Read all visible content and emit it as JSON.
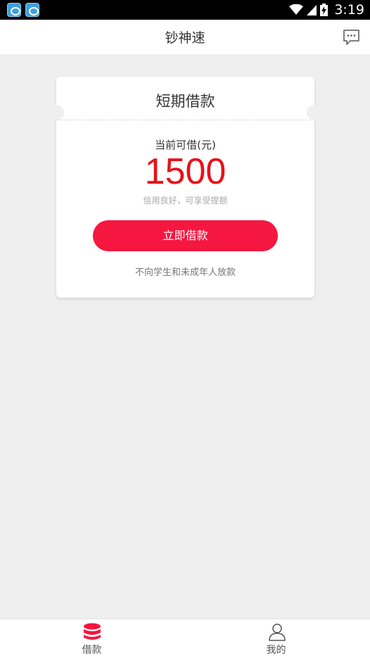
{
  "status_bar": {
    "time": "3:19",
    "notification_icons": [
      "app-icon",
      "app-icon"
    ]
  },
  "header": {
    "title": "钞神速",
    "message_icon": "message-bubble-icon"
  },
  "card": {
    "title": "短期借款",
    "limit_label": "当前可借(元)",
    "limit_amount": "1500",
    "credit_hint": "信用良好，可享受提额",
    "borrow_button": "立即借款",
    "notice": "不向学生和未成年人放款"
  },
  "bottom_nav": {
    "items": [
      {
        "label": "借款",
        "icon": "coin-stack-icon",
        "active": true
      },
      {
        "label": "我的",
        "icon": "user-icon",
        "active": false
      }
    ]
  },
  "colors": {
    "accent": "#f5173f",
    "amount": "#e8111a",
    "background": "#efefef"
  }
}
